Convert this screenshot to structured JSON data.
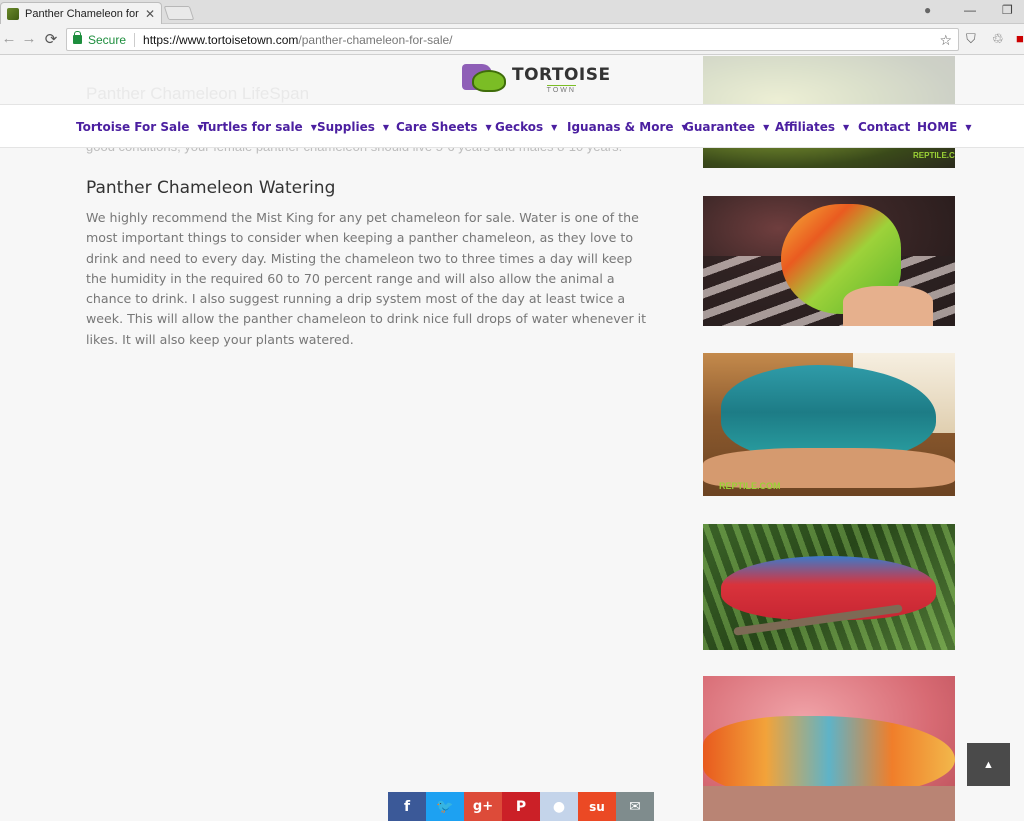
{
  "browser": {
    "tab_title": "Panther Chameleon for sa",
    "close_glyph": "✕",
    "secure_label": "Secure",
    "url_host": "https://www.tortoisetown.com",
    "url_path": "/panther-chameleon-for-sale/",
    "back_glyph": "←",
    "forward_glyph": "→",
    "reload_glyph": "⟳",
    "star_glyph": "☆",
    "account_glyph": "●",
    "minimize_glyph": "—",
    "restore_glyph": "❐"
  },
  "logo": {
    "name": "TORTOISE",
    "sub": "TOWN"
  },
  "nav": {
    "items": [
      {
        "label": "Tortoise For Sale",
        "caret": "▼"
      },
      {
        "label": "Turtles for sale",
        "caret": "▼"
      },
      {
        "label": "Supplies",
        "caret": "▼"
      },
      {
        "label": "Care Sheets",
        "caret": "▼"
      },
      {
        "label": "Geckos",
        "caret": "▼"
      },
      {
        "label": "Iguanas & More",
        "caret": "▼"
      },
      {
        "label": "Guarantee",
        "caret": "▼"
      },
      {
        "label": "Affiliates",
        "caret": "▼"
      },
      {
        "label": "Contact",
        "caret": ""
      },
      {
        "label": "HOME",
        "caret": "▼"
      }
    ]
  },
  "faded": {
    "heading": "Panther Chameleon LifeSpan",
    "text": "good conditions, your female panther chameleon should live 5-6 years and males 8-10 years."
  },
  "article": {
    "heading": "Panther Chameleon Watering",
    "body": "We highly recommend the Mist King for any pet chameleon for sale.  Water is one of the most important things to consider when keeping a panther chameleon, as they love to drink and need to every day. Misting the chameleon two to three times a day will keep the humidity in the required 60 to 70 percent range and will also allow the animal a chance to drink. I also suggest running a drip system most of the day at least twice a week. This will allow the panther chameleon to drink nice full drops of water whenever it likes. It will also keep your plants watered."
  },
  "sidebar": {
    "badge": "REPTILE.COM"
  },
  "scroll_top": {
    "glyph": "▲"
  },
  "share": [
    {
      "name": "facebook",
      "glyph": "f",
      "color": "#3b5998"
    },
    {
      "name": "twitter",
      "glyph": "🐦",
      "color": "#1da1f2"
    },
    {
      "name": "google-plus",
      "glyph": "g+",
      "color": "#dd4b39"
    },
    {
      "name": "pinterest",
      "glyph": "P",
      "color": "#cb2027"
    },
    {
      "name": "reddit",
      "glyph": "●",
      "color": "#c4d4ea"
    },
    {
      "name": "stumbleupon",
      "glyph": "su",
      "color": "#eb4924"
    },
    {
      "name": "email",
      "glyph": "✉",
      "color": "#7f8c8d"
    }
  ]
}
